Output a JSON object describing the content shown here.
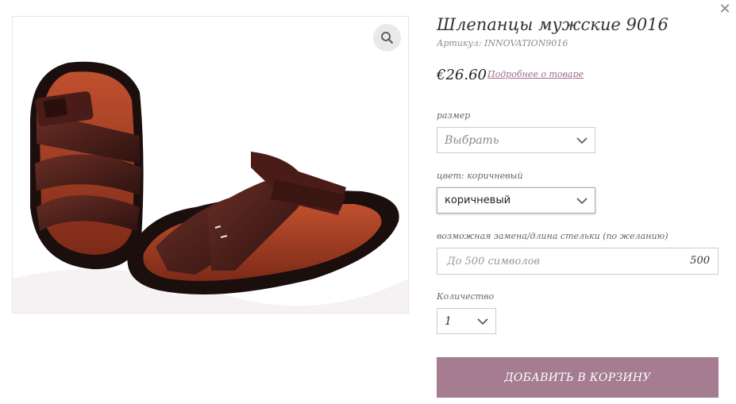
{
  "product": {
    "title": "Шлепанцы мужские 9016",
    "sku": "Артикул: INNOVATION9016",
    "price": "€26.60",
    "more_link": "Подробнее о товаре",
    "image_alt": "Шлепанцы мужские 9016"
  },
  "options": {
    "size": {
      "label": "размер",
      "value": "Выбрать"
    },
    "color": {
      "label": "цвет: коричневый",
      "value": "коричневый"
    },
    "insole": {
      "label": "возможная замена/длина стельки (по желанию)",
      "placeholder": "До 500 символов",
      "counter": "500"
    },
    "quantity": {
      "label": "Количество",
      "value": "1"
    }
  },
  "actions": {
    "add_to_cart": "ДОБАВИТЬ В КОРЗИНУ"
  },
  "icons": {
    "close": "close-icon",
    "zoom": "search-icon",
    "chevron": "chevron-down-icon"
  },
  "colors": {
    "button": "#a57c90",
    "link": "#9b6b8a"
  }
}
